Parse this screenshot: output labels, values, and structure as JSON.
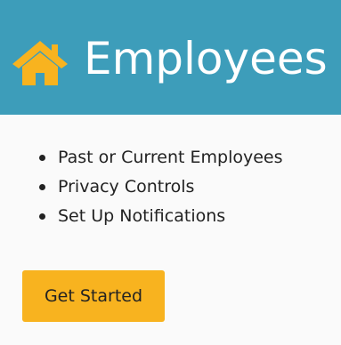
{
  "header": {
    "icon": "home-icon",
    "title": "Employees",
    "background_color": "#3d9dba",
    "icon_color": "#f8b31f"
  },
  "features": {
    "items": [
      {
        "label": "Past or Current Employees"
      },
      {
        "label": "Privacy Controls"
      },
      {
        "label": "Set Up Notifications"
      }
    ]
  },
  "cta": {
    "label": "Get Started",
    "color": "#f8b31f"
  }
}
